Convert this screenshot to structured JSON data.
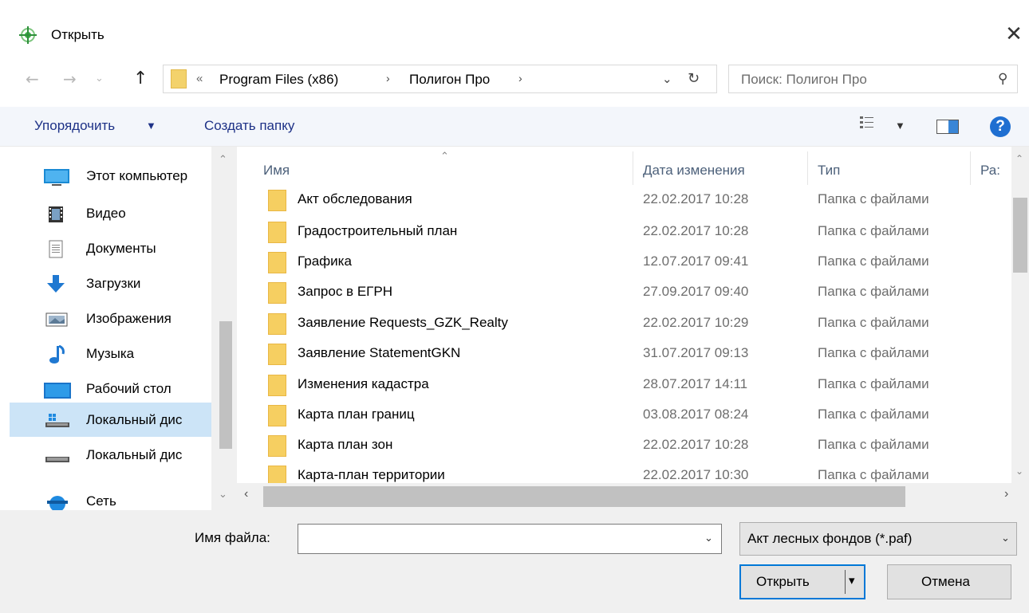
{
  "window": {
    "title": "Открыть",
    "close_glyph": "✕",
    "icon": "app-icon"
  },
  "nav": {
    "back": "←",
    "forward": "→",
    "recent": "⌄",
    "up": "↑"
  },
  "address": {
    "overflow": "«",
    "crumbs": [
      "Program Files (x86)",
      "Полигон Про"
    ],
    "separator": "›",
    "dropdown": "⌄",
    "refresh": "↻"
  },
  "search": {
    "placeholder": "Поиск: Полигон Про",
    "icon": "⚲"
  },
  "toolbar": {
    "organize": "Упорядочить",
    "organize_arrow": "▼",
    "new_folder": "Создать папку",
    "view_arrow": "▼",
    "help": "?"
  },
  "navpane": {
    "items": [
      {
        "label": "Этот компьютер",
        "icon": "computer-icon"
      },
      {
        "label": "Видео",
        "icon": "video-icon"
      },
      {
        "label": "Документы",
        "icon": "documents-icon"
      },
      {
        "label": "Загрузки",
        "icon": "downloads-icon"
      },
      {
        "label": "Изображения",
        "icon": "pictures-icon"
      },
      {
        "label": "Музыка",
        "icon": "music-icon"
      },
      {
        "label": "Рабочий стол",
        "icon": "desktop-icon"
      },
      {
        "label": "Локальный дис",
        "icon": "drive-icon",
        "selected": true
      },
      {
        "label": "Локальный дис",
        "icon": "drive-icon"
      },
      {
        "label": "Сеть",
        "icon": "network-icon"
      }
    ],
    "scroll_up": "⌃",
    "scroll_down": "⌄"
  },
  "columns": {
    "sort_arrow": "⌃",
    "name": "Имя",
    "date": "Дата изменения",
    "type": "Тип",
    "size": "Ра:"
  },
  "files": [
    {
      "name": "Акт обследования",
      "date": "22.02.2017 10:28",
      "type": "Папка с файлами"
    },
    {
      "name": "Градостроительный план",
      "date": "22.02.2017 10:28",
      "type": "Папка с файлами"
    },
    {
      "name": "Графика",
      "date": "12.07.2017 09:41",
      "type": "Папка с файлами"
    },
    {
      "name": "Запрос в ЕГРН",
      "date": "27.09.2017 09:40",
      "type": "Папка с файлами"
    },
    {
      "name": "Заявление Requests_GZK_Realty",
      "date": "22.02.2017 10:29",
      "type": "Папка с файлами"
    },
    {
      "name": "Заявление StatementGKN",
      "date": "31.07.2017 09:13",
      "type": "Папка с файлами"
    },
    {
      "name": "Изменения кадастра",
      "date": "28.07.2017 14:11",
      "type": "Папка с файлами"
    },
    {
      "name": "Карта план границ",
      "date": "03.08.2017 08:24",
      "type": "Папка с файлами"
    },
    {
      "name": "Карта план зон",
      "date": "22.02.2017 10:28",
      "type": "Папка с файлами"
    },
    {
      "name": "Карта-план территории",
      "date": "22.02.2017 10:30",
      "type": "Папка с файлами"
    }
  ],
  "list_scroll": {
    "up": "⌃",
    "down": "⌄",
    "left": "‹",
    "right": "›"
  },
  "footer": {
    "filename_label": "Имя файла:",
    "filename_value": "",
    "filename_drop": "⌄",
    "filter": "Акт лесных фондов (*.paf)",
    "filter_drop": "⌄",
    "open": "Открыть",
    "open_split": "▾",
    "cancel": "Отмена"
  },
  "colors": {
    "accent": "#0078d7",
    "selection": "#cce4f7",
    "folder": "#f6cf61",
    "link_text": "#1e3287"
  }
}
